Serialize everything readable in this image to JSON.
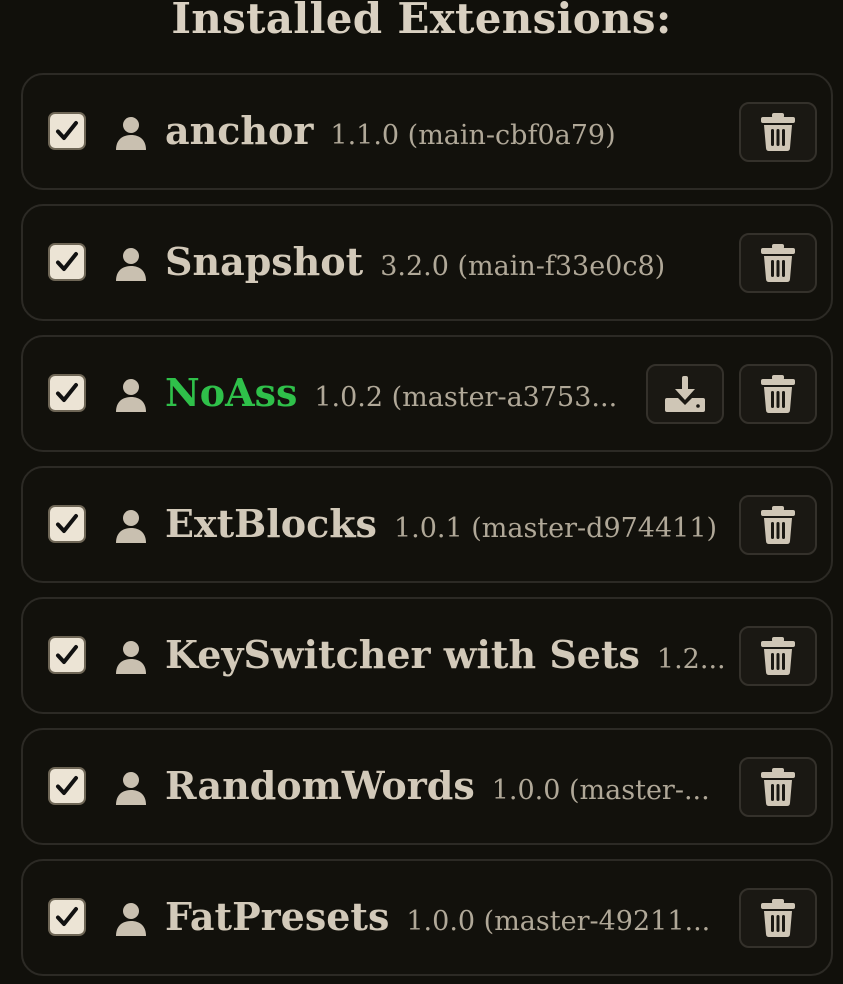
{
  "header": {
    "title": "Installed Extensions:"
  },
  "colors": {
    "background": "#11100b",
    "text": "#d2c9b9",
    "version_text": "#b0a898",
    "highlight_name": "#2fc04a",
    "card_border": "#2c2a25"
  },
  "extensions": [
    {
      "name": "anchor",
      "version": "1.1.0 (main-cbf0a79)",
      "enabled": true,
      "highlighted": false,
      "has_update": false,
      "icon": "user-icon"
    },
    {
      "name": "Snapshot",
      "version": "3.2.0 (main-f33e0c8)",
      "enabled": true,
      "highlighted": false,
      "has_update": false,
      "icon": "user-icon"
    },
    {
      "name": "NoAss",
      "version": "1.0.2 (master-a3753...",
      "enabled": true,
      "highlighted": true,
      "has_update": true,
      "icon": "user-icon"
    },
    {
      "name": "ExtBlocks",
      "version": "1.0.1 (master-d974411)",
      "enabled": true,
      "highlighted": false,
      "has_update": false,
      "icon": "user-icon"
    },
    {
      "name": "KeySwitcher with Sets",
      "version": "1.2...",
      "enabled": true,
      "highlighted": false,
      "has_update": false,
      "icon": "user-icon"
    },
    {
      "name": "RandomWords",
      "version": "1.0.0 (master-...",
      "enabled": true,
      "highlighted": false,
      "has_update": false,
      "icon": "user-icon"
    },
    {
      "name": "FatPresets",
      "version": "1.0.0 (master-49211...",
      "enabled": true,
      "highlighted": false,
      "has_update": false,
      "icon": "user-icon"
    }
  ]
}
